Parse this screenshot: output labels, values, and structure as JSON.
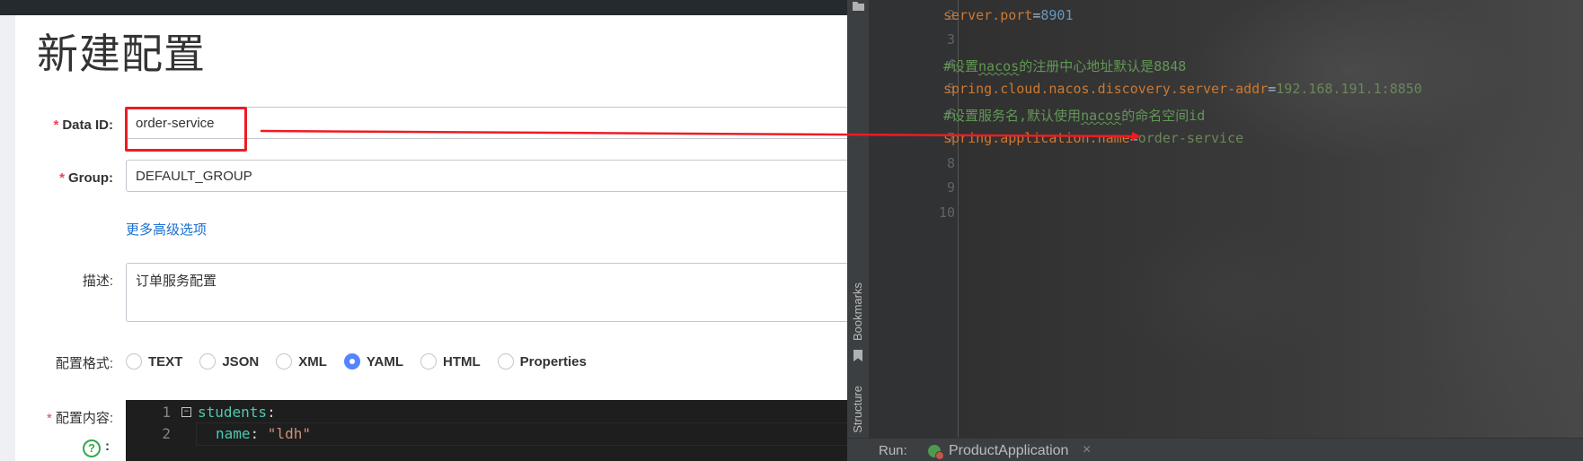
{
  "page_title": "新建配置",
  "form": {
    "data_id_label": "Data ID:",
    "data_id_value": "order-service",
    "group_label": "Group:",
    "group_value": "DEFAULT_GROUP",
    "advanced_link": "更多高级选项",
    "desc_label": "描述:",
    "desc_value": "订单服务配置",
    "format_label": "配置格式:",
    "formats": [
      "TEXT",
      "JSON",
      "XML",
      "YAML",
      "HTML",
      "Properties"
    ],
    "selected_format": "YAML",
    "content_label": "配置内容:",
    "required_mark": "*",
    "help_mark": "?",
    "help_colon": ":"
  },
  "yaml_editor": {
    "line_numbers": [
      "1",
      "2"
    ],
    "fold_marker": "⊟",
    "line1_key": "students",
    "line1_colon": ":",
    "line2_key": "name",
    "line2_colon": ": ",
    "line2_value": "\"ldh\""
  },
  "ide": {
    "side_tabs": [
      "Bookmarks",
      "Structure"
    ],
    "line_numbers": [
      "2",
      "3",
      "4",
      "5",
      "6",
      "7",
      "8",
      "9",
      "10"
    ],
    "code": {
      "l2_key": "server.port",
      "l2_eq": "=",
      "l2_val": "8901",
      "l4_a": "#设置",
      "l4_b": "nacos",
      "l4_c": "的注册中心地址默认是8848",
      "l5_key": "spring.cloud.nacos.discovery.server-addr",
      "l5_eq": "=",
      "l5_val": "192.168.191.1:8850",
      "l6_a": "#设置服务名,默认使用",
      "l6_b": "nacos",
      "l6_c": "的命名空间id",
      "l7_key": "spring.application.name",
      "l7_eq": "=",
      "l7_val": "order-service"
    },
    "run_label": "Run:",
    "run_tab": "ProductApplication",
    "run_close": "×"
  },
  "colors": {
    "annotation_red": "#ed1c24",
    "link_blue": "#1a6fd1",
    "radio_selected": "#5584ff",
    "ide_keyword": "#cc7832",
    "ide_string": "#6a8759",
    "ide_number": "#6897bb",
    "ide_comment": "#629755"
  }
}
